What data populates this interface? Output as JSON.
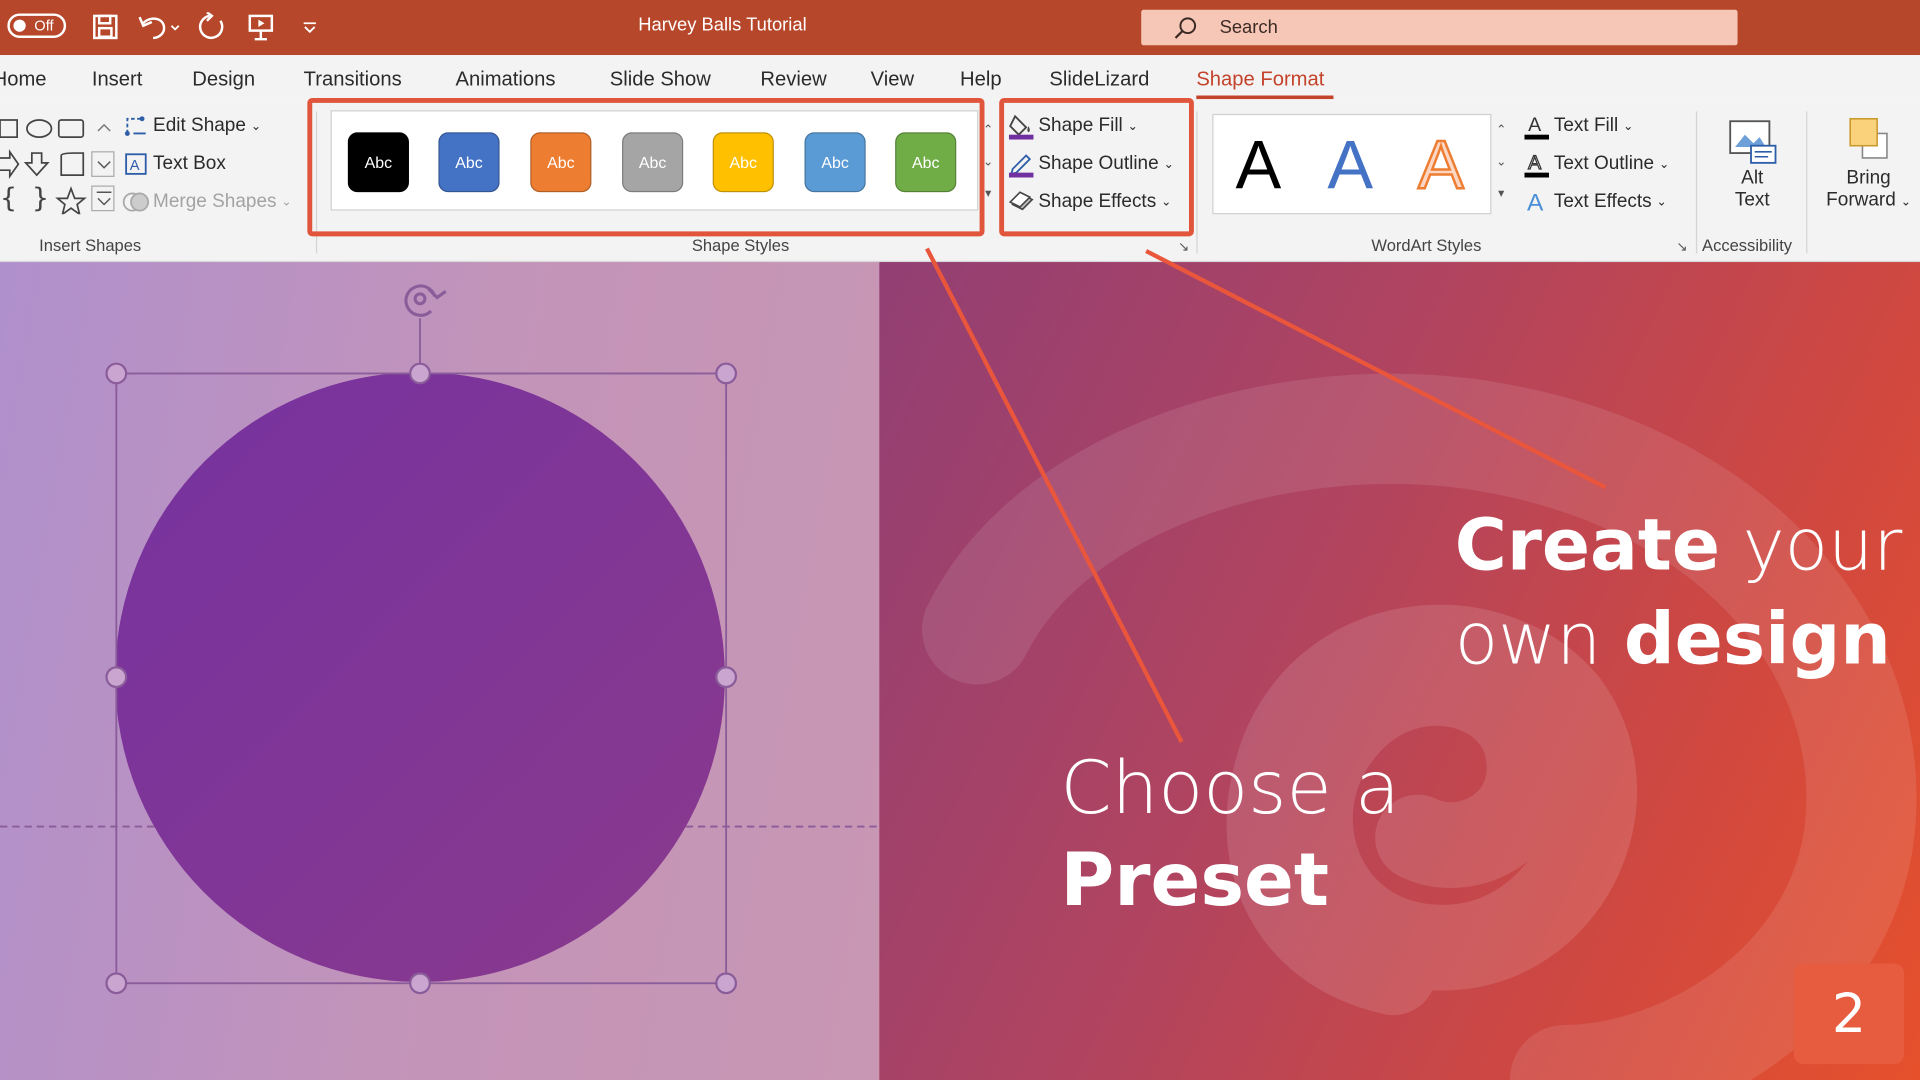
{
  "titlebar": {
    "autosave_label": "Off",
    "doc_title": "Harvey Balls Tutorial",
    "search_placeholder": "Search"
  },
  "tabs": [
    "Home",
    "Insert",
    "Design",
    "Transitions",
    "Animations",
    "Slide Show",
    "Review",
    "View",
    "Help",
    "SlideLizard",
    "Shape Format"
  ],
  "active_tab": "Shape Format",
  "ribbon": {
    "insert_shapes": {
      "label": "Insert Shapes",
      "edit_shape": "Edit Shape",
      "text_box": "Text Box",
      "merge_shapes": "Merge Shapes"
    },
    "shape_styles": {
      "label": "Shape Styles",
      "preset_text": "Abc",
      "preset_colors": [
        "#000000",
        "#4472c4",
        "#ed7d31",
        "#a5a5a5",
        "#ffc000",
        "#5b9bd5",
        "#70ad47"
      ],
      "shape_fill": "Shape Fill",
      "shape_outline": "Shape Outline",
      "shape_effects": "Shape Effects"
    },
    "wordart": {
      "label": "WordArt Styles",
      "preview_glyph": "A",
      "text_fill": "Text Fill",
      "text_outline": "Text Outline",
      "text_effects": "Text Effects"
    },
    "accessibility": {
      "label": "Accessibility",
      "alt_text_line1": "Alt",
      "alt_text_line2": "Text"
    },
    "arrange": {
      "bring_forward_line1": "Bring",
      "bring_forward_line2": "Forward"
    }
  },
  "slide": {
    "caption_preset_line1": "Choose a",
    "caption_preset_line2": "Preset",
    "caption_design_bold1": "Create",
    "caption_design_light1": "your",
    "caption_design_light2": "own",
    "caption_design_bold2": "design",
    "slide_number": "2"
  },
  "colors": {
    "accent": "#b7472a",
    "highlight": "#e0553b",
    "shape_fill": "#7b3597"
  }
}
